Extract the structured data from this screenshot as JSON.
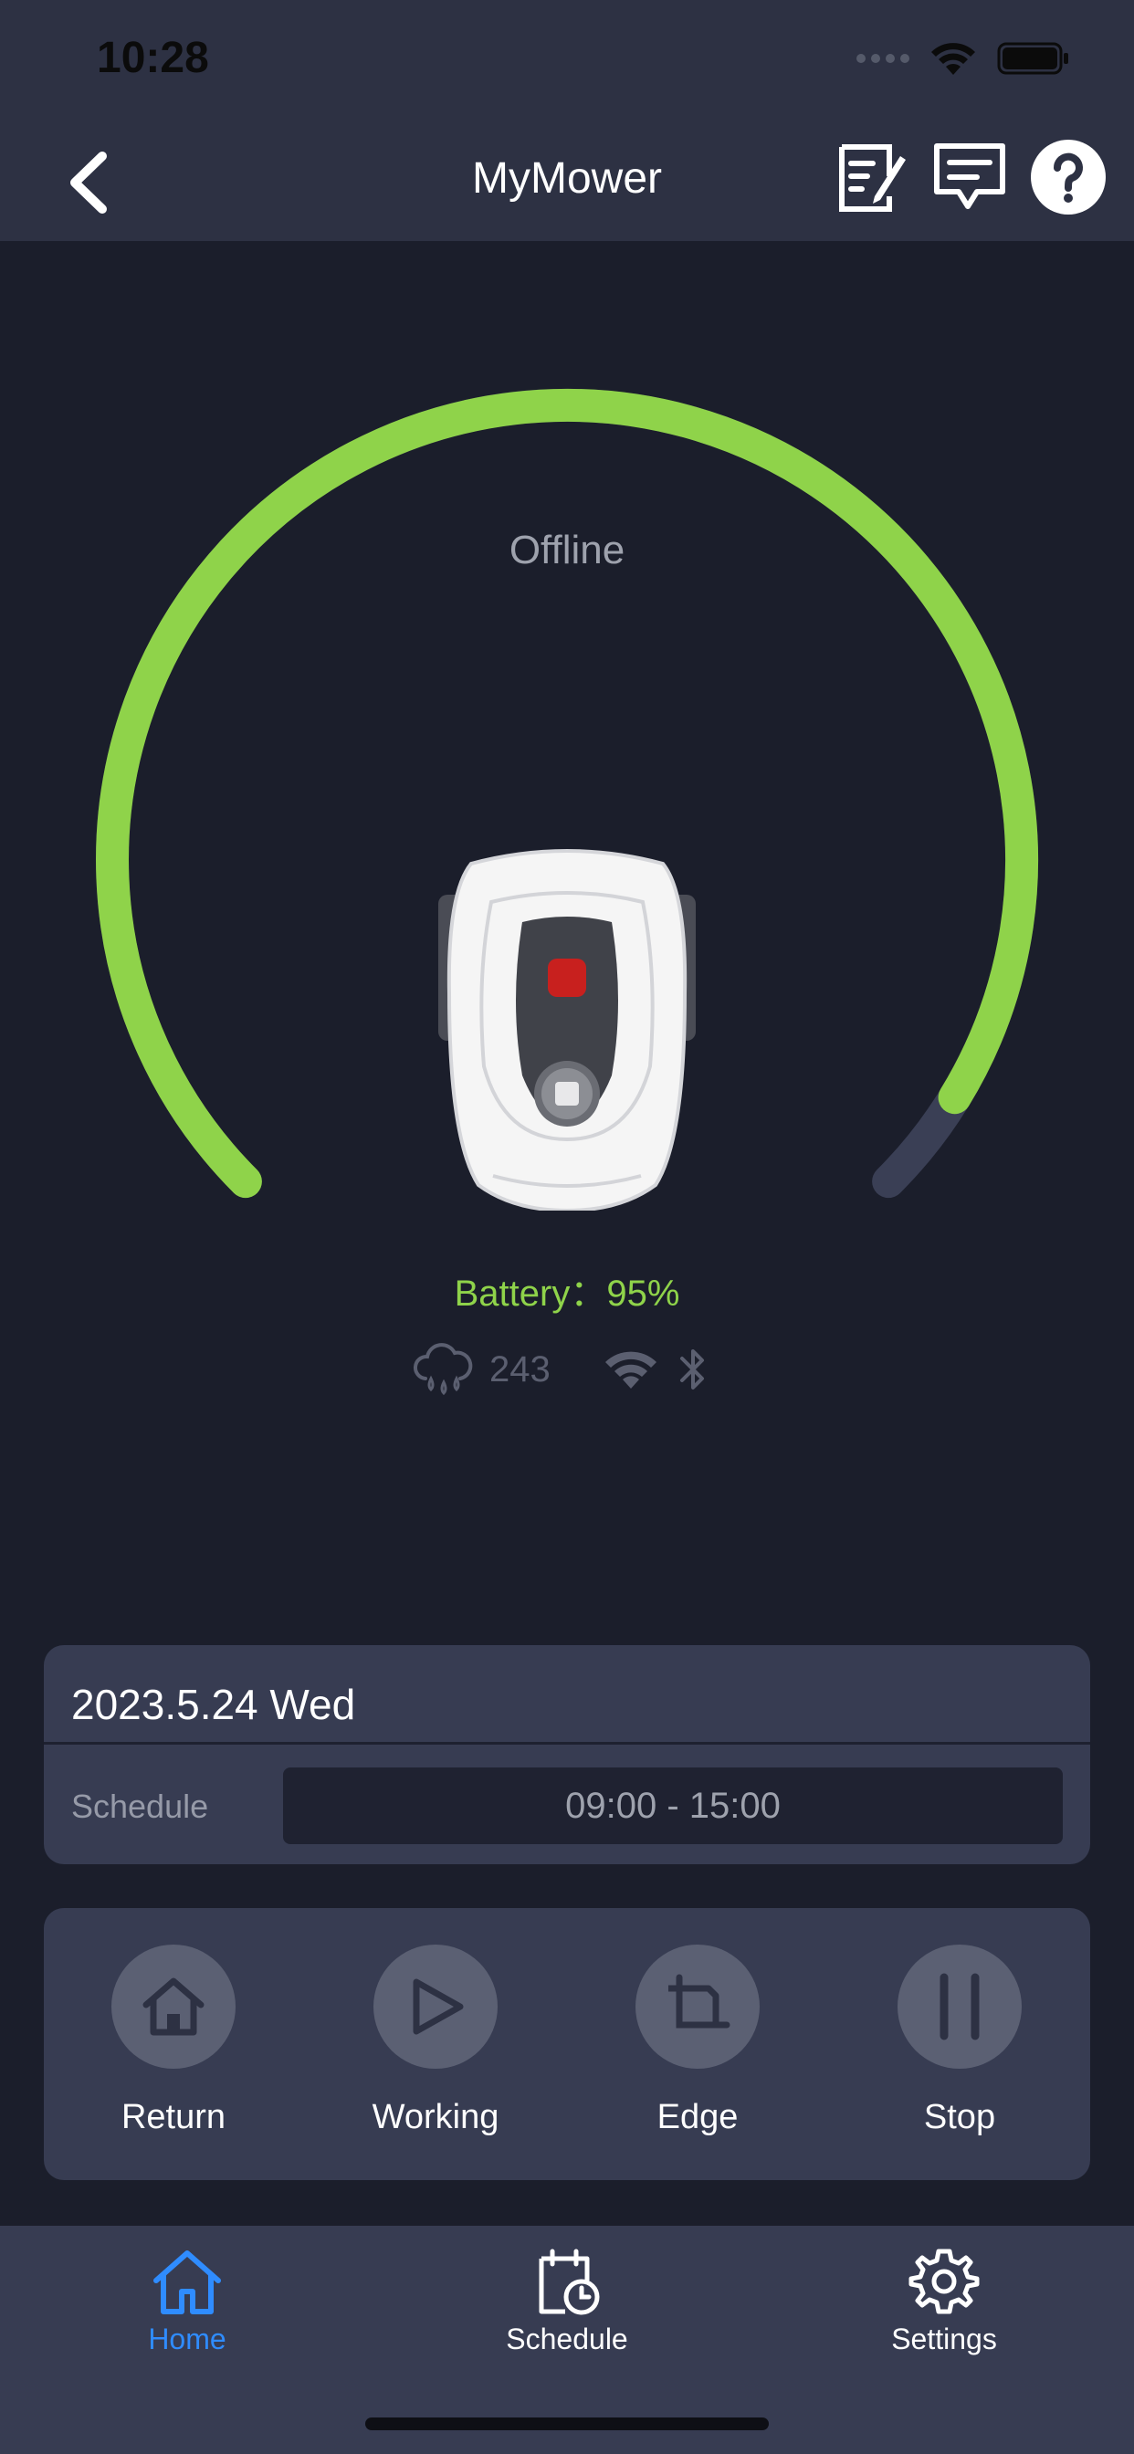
{
  "status_bar": {
    "time": "10:28"
  },
  "header": {
    "title": "MyMower"
  },
  "mower": {
    "state": "Offline",
    "battery_label": "Battery：",
    "battery_value": "95%",
    "battery_level": 0.95,
    "rain_value": "243"
  },
  "schedule_card": {
    "date": "2023.5.24 Wed",
    "label": "Schedule",
    "time_range": "09:00 - 15:00"
  },
  "actions": [
    {
      "label": "Return",
      "icon": "home-icon"
    },
    {
      "label": "Working",
      "icon": "play-icon"
    },
    {
      "label": "Edge",
      "icon": "edge-icon"
    },
    {
      "label": "Stop",
      "icon": "pause-icon"
    }
  ],
  "tabs": [
    {
      "label": "Home",
      "icon": "home-icon",
      "active": true
    },
    {
      "label": "Schedule",
      "icon": "calendar-clock-icon",
      "active": false
    },
    {
      "label": "Settings",
      "icon": "gear-icon",
      "active": false
    }
  ],
  "colors": {
    "accent_green": "#8fd34a",
    "active_tab": "#2f8cff",
    "card": "#373c52",
    "background": "#1b1e2b",
    "header": "#2d3143"
  }
}
